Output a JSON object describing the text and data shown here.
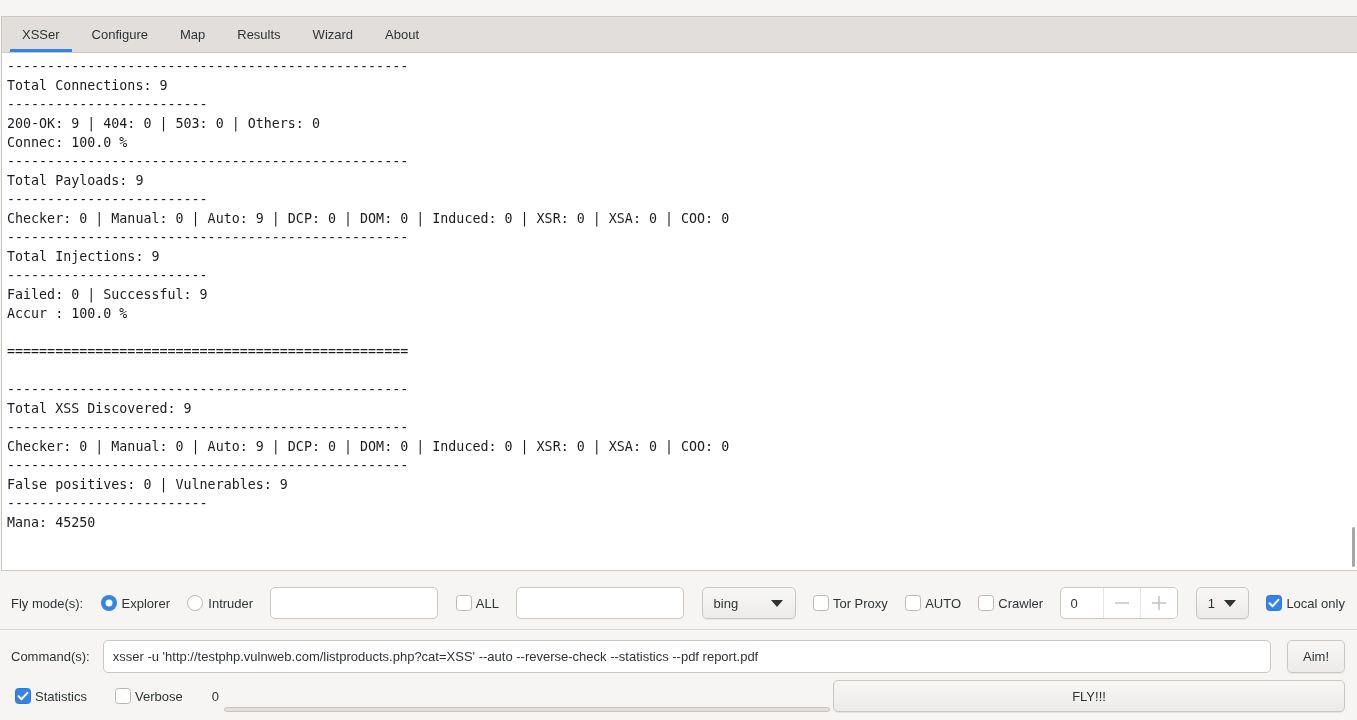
{
  "tabs": [
    {
      "label": "XSSer",
      "selected": true
    },
    {
      "label": "Configure",
      "selected": false
    },
    {
      "label": "Map",
      "selected": false
    },
    {
      "label": "Results",
      "selected": false
    },
    {
      "label": "Wizard",
      "selected": false
    },
    {
      "label": "About",
      "selected": false
    }
  ],
  "output": {
    "blocks": [
      [
        "--------------------------------------------------",
        "Total Connections: 9",
        "-------------------------",
        "200-OK: 9 | 404: 0 | 503: 0 | Others: 0",
        "Connec: 100.0 %",
        "--------------------------------------------------",
        "Total Payloads: 9",
        "-------------------------",
        "Checker: 0 | Manual: 0 | Auto: 9 | DCP: 0 | DOM: 0 | Induced: 0 | XSR: 0 | XSA: 0 | COO: 0",
        "--------------------------------------------------",
        "Total Injections: 9",
        "-------------------------",
        "Failed: 0 | Successful: 9",
        "Accur : 100.0 %"
      ],
      [
        "=================================================="
      ],
      [
        "--------------------------------------------------",
        "Total XSS Discovered: 9",
        "--------------------------------------------------",
        "Checker: 0 | Manual: 0 | Auto: 9 | DCP: 0 | DOM: 0 | Induced: 0 | XSR: 0 | XSA: 0 | COO: 0",
        "--------------------------------------------------",
        "False positives: 0 | Vulnerables: 9",
        "-------------------------",
        "Mana: 45250"
      ]
    ]
  },
  "fly_mode": {
    "label": "Fly mode(s):",
    "options": [
      {
        "label": "Explorer",
        "selected": true
      },
      {
        "label": "Intruder",
        "selected": false
      }
    ]
  },
  "controls": [
    {
      "kind": "input"
    },
    {
      "kind": "checkbox",
      "label": "ALL",
      "checked": false
    },
    {
      "kind": "input"
    },
    {
      "kind": "dropdown",
      "value": "bing"
    },
    {
      "kind": "checkbox",
      "label": "Tor Proxy",
      "checked": false
    },
    {
      "kind": "checkbox",
      "label": "AUTO",
      "checked": false
    },
    {
      "kind": "checkbox",
      "label": "Crawler",
      "checked": false
    },
    {
      "kind": "spinbox",
      "value": "0"
    },
    {
      "kind": "dropdown",
      "value": "1"
    },
    {
      "kind": "checkbox",
      "label": "Local only",
      "checked": true
    }
  ],
  "command": {
    "label": "Command(s):",
    "value": "xsser -u 'http://testphp.vulnweb.com/listproducts.php?cat=XSS' --auto --reverse-check --statistics --pdf report.pdf",
    "button": "Aim!"
  },
  "run": {
    "options": [
      {
        "label": "Statistics",
        "checked": true
      },
      {
        "label": "Verbose",
        "checked": false
      }
    ],
    "progress": {
      "reading": "0"
    },
    "button": "FLY!!!"
  }
}
